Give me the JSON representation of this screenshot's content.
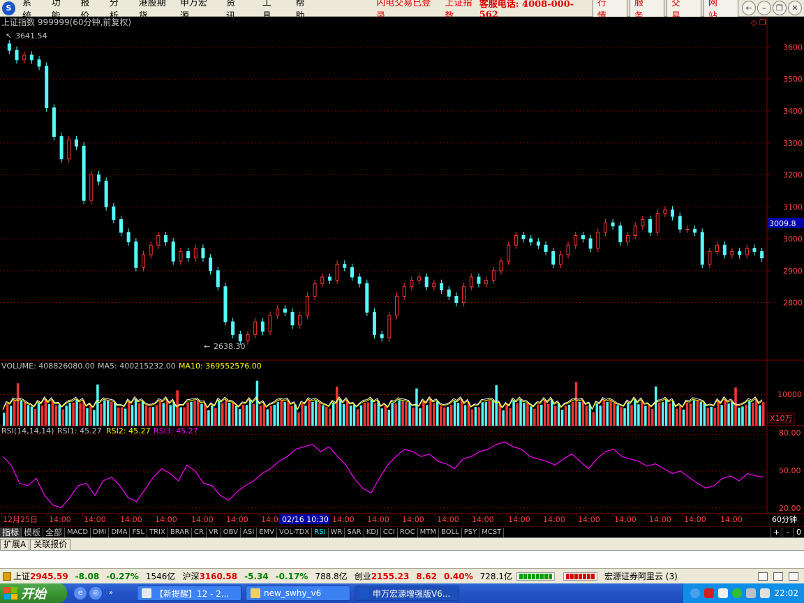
{
  "menu": {
    "logo": "S",
    "items": [
      "系统",
      "功能",
      "报价",
      "分析",
      "港股期货",
      "申万宏源",
      "资讯",
      "工具",
      "帮助"
    ],
    "status_login": "闪电交易已登录",
    "status_index": "上证指数",
    "hotline": "客服电话: 4008-000-562",
    "tool_buttons": [
      "行情",
      "服务",
      "交易",
      "网站"
    ],
    "window_buttons": [
      "←",
      "–",
      "❐",
      "✕"
    ]
  },
  "chart_header": {
    "title": "上证指数 999999(60分钟,前复权)",
    "max_label": "3641.54",
    "min_label": "2638.30",
    "current_price": "3009.8",
    "window_icons": "◇ ❐"
  },
  "volume_header": {
    "label": "VOLUME: 408826080.00",
    "ma5": "MA5: 400215232.00",
    "ma10": "MA10: 369552576.00",
    "unit": "X10万",
    "axis_value": "10000"
  },
  "rsi_header": {
    "label": "RSI(14,14,14)",
    "rsi1": "RSI1: 45.27",
    "rsi2": "RSI2: 45.27",
    "rsi3": "RSI3: 45.27",
    "axis": [
      "80.00",
      "50.00",
      "20.00"
    ]
  },
  "x_axis": {
    "labels": [
      "12月25日",
      "14:00",
      "14:00",
      "14:00",
      "14:00",
      "14:00",
      "14:00",
      "14:00",
      "14:00",
      "14:00",
      "14:00",
      "14:00",
      "14:00",
      "14:00",
      "14:00",
      "14:00",
      "14:00",
      "14:00",
      "14:00",
      "14:00",
      "14:00"
    ],
    "cursor_label": "02/16 10:30",
    "period": "60分钟"
  },
  "chart_data": {
    "type": "candlestick",
    "y_axis_labels": [
      "3600",
      "3500",
      "3400",
      "3300",
      "3200",
      "3100",
      "3000",
      "2900",
      "2800"
    ],
    "ylim": [
      2620,
      3660
    ],
    "close_series": [
      3590,
      3560,
      3575,
      3560,
      3540,
      3410,
      3320,
      3250,
      3310,
      3290,
      3120,
      3200,
      3180,
      3100,
      3060,
      3020,
      2990,
      2910,
      2950,
      2980,
      3010,
      2990,
      2930,
      2960,
      2940,
      2970,
      2940,
      2900,
      2850,
      2740,
      2700,
      2680,
      2700,
      2740,
      2710,
      2760,
      2780,
      2770,
      2730,
      2760,
      2820,
      2860,
      2880,
      2870,
      2920,
      2910,
      2880,
      2860,
      2770,
      2700,
      2690,
      2760,
      2820,
      2850,
      2870,
      2880,
      2850,
      2860,
      2840,
      2820,
      2800,
      2850,
      2880,
      2860,
      2870,
      2900,
      2930,
      2980,
      3010,
      3000,
      2990,
      2980,
      2960,
      2920,
      2950,
      2980,
      3010,
      3000,
      2970,
      3020,
      3050,
      3040,
      2990,
      3010,
      3040,
      3060,
      3020,
      3080,
      3090,
      3070,
      3030,
      3030,
      3020,
      2920,
      2960,
      2980,
      2950,
      2960,
      2950,
      2970,
      2960,
      2940
    ],
    "volume_ylim": [
      0,
      18000
    ],
    "rsi_ylim": [
      15,
      85
    ],
    "rsi_series": [
      62,
      55,
      40,
      38,
      44,
      30,
      22,
      20,
      28,
      38,
      40,
      30,
      42,
      45,
      38,
      28,
      25,
      35,
      45,
      52,
      48,
      42,
      55,
      50,
      40,
      38,
      30,
      26,
      33,
      38,
      42,
      48,
      52,
      58,
      62,
      68,
      70,
      72,
      66,
      70,
      62,
      55,
      44,
      36,
      32,
      44,
      55,
      62,
      68,
      66,
      62,
      64,
      58,
      56,
      52,
      60,
      62,
      66,
      68,
      72,
      74,
      70,
      68,
      62,
      60,
      58,
      55,
      60,
      64,
      58,
      52,
      60,
      66,
      68,
      62,
      60,
      58,
      54,
      56,
      52,
      48,
      50,
      45,
      40,
      36,
      38,
      44,
      46,
      42,
      48,
      46,
      45
    ]
  },
  "indicators": {
    "cn_tabs": [
      "指标",
      "模板",
      "全部"
    ],
    "tabs": [
      "MACD",
      "DMI",
      "DMA",
      "FSL",
      "TRIX",
      "BRAR",
      "CR",
      "VR",
      "OBV",
      "ASI",
      "EMV",
      "VOL-TDX",
      "RSI",
      "WR",
      "SAR",
      "KDJ",
      "CCI",
      "ROC",
      "MTM",
      "BOLL",
      "PSY",
      "MCST"
    ],
    "active": "RSI",
    "controls": [
      "+",
      "-",
      "0"
    ]
  },
  "bottom_tabs": [
    "扩展A",
    "关联报价"
  ],
  "ticker": {
    "sh_name": "上证",
    "sh_price": "2945.59",
    "sh_change": "-8.08",
    "sh_pct": "-0.27%",
    "sh_vol": "1546亿",
    "hs_name": "沪深",
    "hs_price": "3160.58",
    "hs_change": "-5.34",
    "hs_pct": "-0.17%",
    "hs_vol": "788.8亿",
    "cy_name": "创业",
    "cy_price": "2155.23",
    "cy_change": "8.62",
    "cy_pct": "0.40%",
    "cy_vol": "728.1亿",
    "broker": "宏源证券阿里云 (3)"
  },
  "taskbar": {
    "start": "开始",
    "tasks": [
      "【新提醒】12 - 2...",
      "new_swhy_v6",
      "申万宏源增强版V6..."
    ],
    "clock": "22:02",
    "quicklaunch": [
      "e",
      "◎",
      "»"
    ]
  },
  "colors": {
    "up": "#ff3232",
    "down": "#54fcfc",
    "ma5": "#ffffff",
    "ma10": "#ffff00",
    "rsi": "#ff00ff",
    "grid": "#800000",
    "axis_text": "#ff4040"
  }
}
